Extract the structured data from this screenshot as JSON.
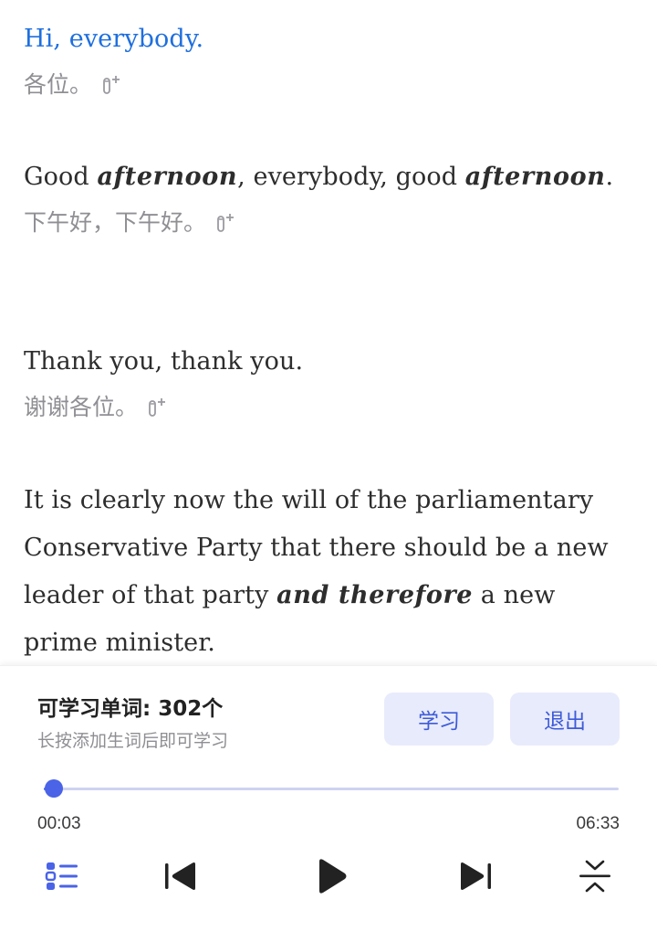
{
  "transcript": [
    {
      "en": [
        {
          "t": "Hi, everybody."
        }
      ],
      "zh": "各位。",
      "active": true
    },
    {
      "en": [
        {
          "t": "Good "
        },
        {
          "t": "afternoon",
          "bold": true
        },
        {
          "t": ", everybody, good "
        },
        {
          "t": "afternoon",
          "bold": true
        },
        {
          "t": "."
        }
      ],
      "zh": "下午好，下午好。"
    },
    {
      "en": [
        {
          "t": "Thank you, thank you."
        }
      ],
      "zh": "谢谢各位。"
    },
    {
      "en": [
        {
          "t": "It is clearly now the will of the parliamentary Conservative Party that there should be a new leader of that party "
        },
        {
          "t": "and therefore",
          "bold": true
        },
        {
          "t": " a new prime minister."
        }
      ],
      "zh": ""
    }
  ],
  "panel": {
    "vocab_title": "可学习单词: 302个",
    "vocab_hint": "长按添加生词后即可学习",
    "learn_label": "学习",
    "exit_label": "退出"
  },
  "player": {
    "current_time": "00:03",
    "total_time": "06:33",
    "progress": 0.008
  },
  "colors": {
    "accent": "#4a63e7",
    "active_text": "#1e6fde",
    "button_bg": "#e8ebfb"
  },
  "icons": {
    "add_word": "add-word-icon",
    "playlist": "playlist-icon",
    "prev": "skip-previous-icon",
    "play": "play-icon",
    "next": "skip-next-icon",
    "collapse": "collapse-icon"
  }
}
